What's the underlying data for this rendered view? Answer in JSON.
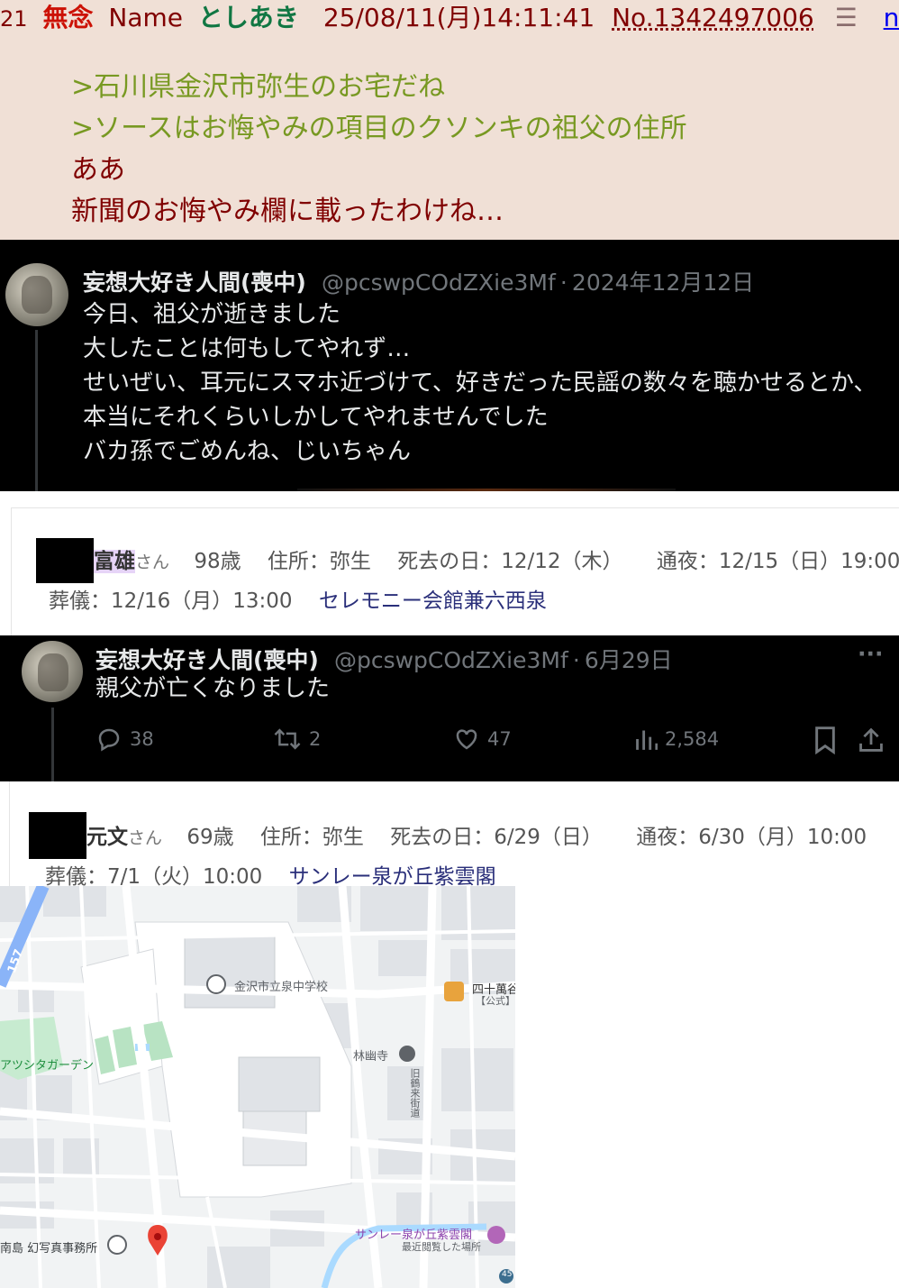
{
  "post": {
    "number": "21",
    "subject": "無念",
    "name_label": "Name",
    "name": "としあき",
    "date": "25/08/11(月)14:11:41",
    "post_no": "No.1342497006",
    "menu_icon": "list-icon",
    "link_fragment": "n",
    "lines": [
      {
        "text": ">石川県金沢市弥生のお宅だね",
        "kind": "quote"
      },
      {
        "text": ">ソースはお悔やみの項目のクソンキの祖父の住所",
        "kind": "quote"
      },
      {
        "text": "ああ",
        "kind": "body"
      },
      {
        "text": "新聞のお悔やみ欄に載ったわけね…",
        "kind": "body"
      }
    ]
  },
  "tweet1": {
    "name": "妄想大好き人間(喪中)",
    "handle": "@pcswpCOdZXie3Mf",
    "dot": "·",
    "date": "2024年12月12日",
    "lines": [
      "今日、祖父が逝きました",
      "大したことは何もしてやれず…",
      "せいぜい、耳元にスマホ近づけて、好きだった民謡の数々を聴かせるとか、",
      "本当にそれくらいしかしてやれませんでした",
      "バカ孫でごめんね、じいちゃん"
    ]
  },
  "obit1": {
    "name": "富雄",
    "san": "さん",
    "age": "98歳",
    "address": "住所：弥生",
    "death": "死去の日：12/12（木）",
    "wake": "通夜：12/15（日）19:00",
    "funeral": "葬儀：12/16（月）13:00",
    "venue": "セレモニー会館兼六西泉"
  },
  "tweet2": {
    "name": "妄想大好き人間(喪中)",
    "handle": "@pcswpCOdZXie3Mf",
    "dot": "·",
    "date": "6月29日",
    "more": "···",
    "text": "親父が亡くなりました",
    "replies": "38",
    "retweets": "2",
    "likes": "47",
    "views": "2,584"
  },
  "obit2": {
    "name": "元文",
    "san": "さん",
    "age": "69歳",
    "address": "住所：弥生",
    "death": "死去の日：6/29（日）",
    "wake": "通夜：6/30（月）10:00",
    "funeral": "葬儀：7/1（火）10:00",
    "venue": "サンレー泉が丘紫雲閣"
  },
  "map": {
    "labels": {
      "school": "金沢市立泉中学校",
      "shop": "四十萬谷",
      "shop_sub": "【公式】i",
      "temple": "林幽寺",
      "garden": "アツシタガーデン",
      "road_number": "157",
      "road_bottom": "45",
      "street": "旧鶴来街道",
      "hall": "サンレー泉が丘紫雲閣",
      "hall_sub": "最近閲覧した場所",
      "photo": "南島 幻写真事務所"
    },
    "colors": {
      "background": "#f1f3f4",
      "road": "#ffffff",
      "building": "#e0e3e7",
      "park": "#c7ebd0",
      "water": "#aadaff",
      "pin": "#ea4335"
    }
  }
}
